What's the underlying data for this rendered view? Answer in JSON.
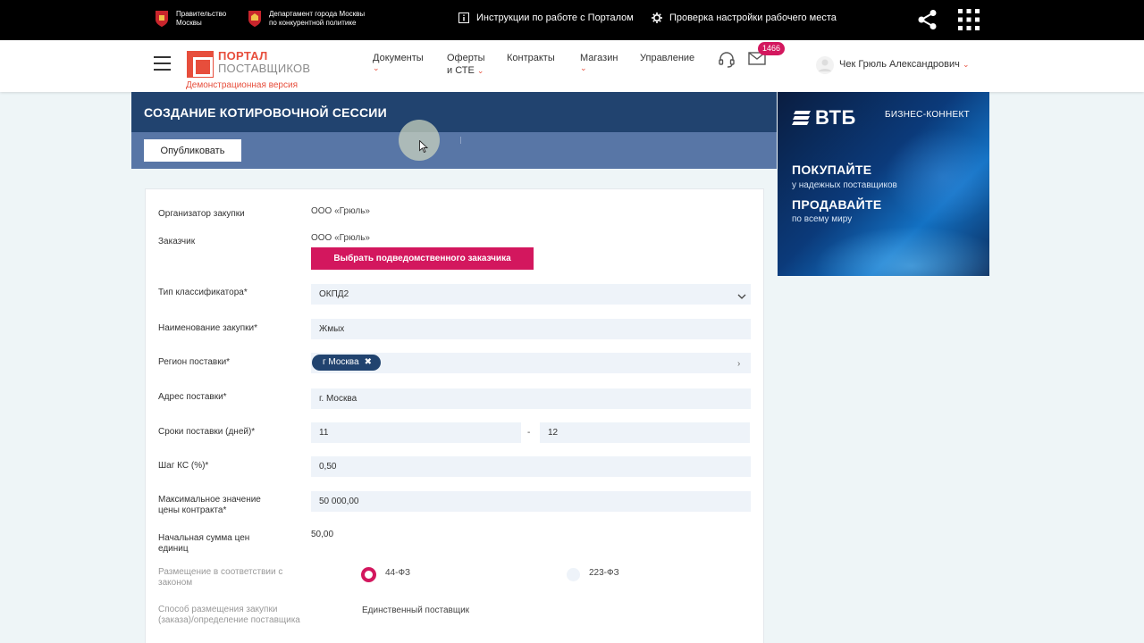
{
  "topbar": {
    "gov1": {
      "line1": "Правительство",
      "line2": "Москвы"
    },
    "gov2": {
      "line1": "Департамент города Москвы",
      "line2": "по конкурентной политике"
    },
    "links": {
      "instructions": "Инструкции по работе с Порталом",
      "setup": "Проверка настройки рабочего места"
    },
    "icons": {
      "share": "share-icon",
      "apps": "apps-grid-icon"
    }
  },
  "header": {
    "logo": {
      "title": "ПОРТАЛ",
      "subtitle": "ПОСТАВЩИКОВ",
      "demo": "Демонстрационная версия"
    },
    "nav": {
      "documents": "Документы",
      "offers_line1": "Оферты",
      "offers_line2": "и СТЕ",
      "contracts": "Контракты",
      "shop": "Магазин",
      "management": "Управление"
    },
    "mail_count": "1466",
    "user_name": "Чек Грюль Александрович"
  },
  "page": {
    "title": "СОЗДАНИЕ КОТИРОВОЧНОЙ СЕССИИ",
    "publish_label": "Опубликовать"
  },
  "form": {
    "organizer": {
      "label": "Организатор закупки",
      "value": "ООО «Грюль»"
    },
    "customer": {
      "label": "Заказчик",
      "value": "ООО «Грюль»",
      "button": "Выбрать подведомственного заказчика"
    },
    "classifier": {
      "label": "Тип классификатора*",
      "value": "ОКПД2"
    },
    "purchase_name": {
      "label": "Наименование закупки*",
      "value": "Жмых"
    },
    "region": {
      "label": "Регион поставки*",
      "tag": "г Москва"
    },
    "address": {
      "label": "Адрес поставки*",
      "value": "г. Москва"
    },
    "delivery_terms": {
      "label": "Сроки поставки (дней)*",
      "from": "11",
      "separator": "-",
      "to": "12"
    },
    "step": {
      "label": "Шаг КС (%)*",
      "value": "0,50"
    },
    "max_price": {
      "label_line1": "Максимальное значение",
      "label_line2": "цены контракта*",
      "value": "50 000,00"
    },
    "unit_sum": {
      "label_line1": "Начальная сумма цен",
      "label_line2": "единиц",
      "value": "50,00"
    },
    "law": {
      "label_line1": "Размещение в соответствии с",
      "label_line2": "законом",
      "option1": "44-ФЗ",
      "option2": "223-ФЗ",
      "selected": "44-ФЗ"
    },
    "method": {
      "label_line1": "Способ размещения закупки",
      "label_line2": "(заказа)/определение поставщика",
      "value": "Единственный поставщик"
    }
  },
  "ad": {
    "brand": "ВТБ",
    "brand_suffix": "БИЗНЕС-КОННЕКТ",
    "buy": "ПОКУПАЙТЕ",
    "buy_sub": "у надежных поставщиков",
    "sell": "ПРОДАВАЙТЕ",
    "sell_sub": "по всему миру"
  },
  "colors": {
    "accent": "#d3175e",
    "navy": "#21436f",
    "toolbar": "#5876a6",
    "brand_red": "#e74e3c"
  }
}
